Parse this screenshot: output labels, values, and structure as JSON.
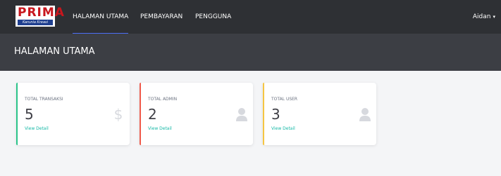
{
  "logo": {
    "text": "PRIMA",
    "tagline": "Karunia Kreasi"
  },
  "nav": {
    "items": [
      {
        "label": "HALAMAN UTAMA",
        "active": true
      },
      {
        "label": "PEMBAYARAN",
        "active": false
      },
      {
        "label": "PENGGUNA",
        "active": false
      }
    ]
  },
  "user": {
    "name": "Aidan",
    "caret": "▾"
  },
  "page": {
    "title": "HALAMAN UTAMA"
  },
  "cards": [
    {
      "label": "TOTAL TRANSAKSI",
      "value": "5",
      "link": "View Detail",
      "accent": "#2bc48a",
      "icon": "dollar-icon"
    },
    {
      "label": "TOTAL ADMIN",
      "value": "2",
      "link": "View Detail",
      "accent": "#ef5a4b",
      "icon": "user-icon"
    },
    {
      "label": "TOTAL USER",
      "value": "3",
      "link": "View Detail",
      "accent": "#f5c542",
      "icon": "user-icon"
    }
  ],
  "colors": {
    "topbar": "#2e3034",
    "header_band": "#3c3e44",
    "link": "#14b8a6",
    "nav_active": "#4c6ef5"
  }
}
